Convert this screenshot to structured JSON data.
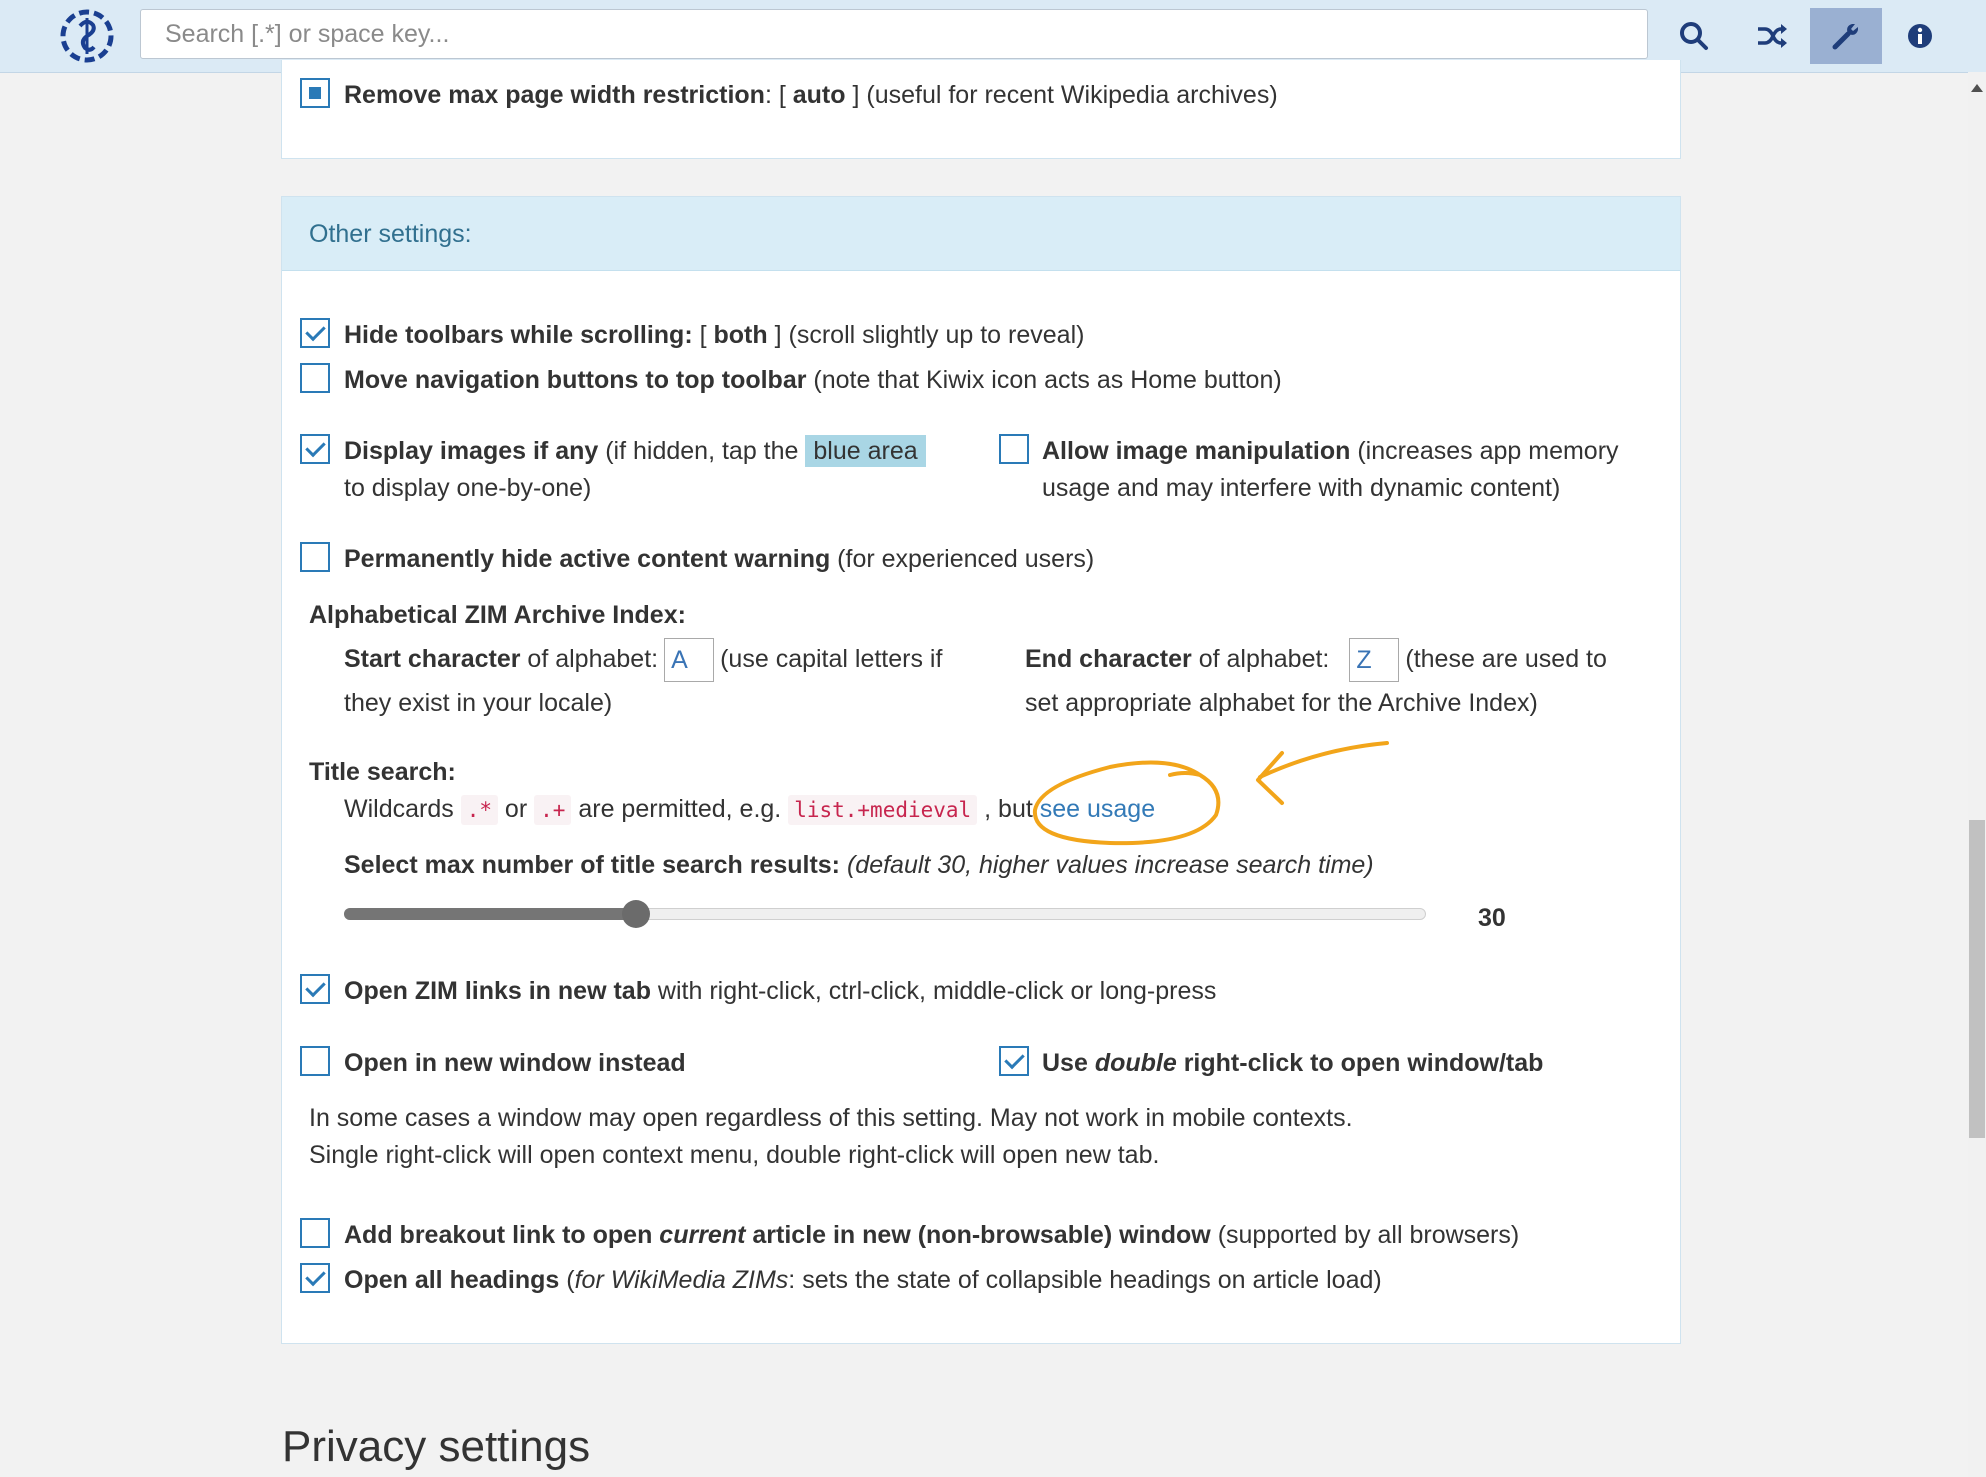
{
  "toolbar": {
    "search_placeholder": "Search [.*] or space key...",
    "buttons": [
      "search-icon",
      "random-shuffle-icon",
      "wrench-settings-icon",
      "info-icon"
    ],
    "active_button": "wrench-settings-icon"
  },
  "display": {
    "max_width": {
      "label": "Remove max page width restriction",
      "state_open": ": [ ",
      "state": "auto",
      "state_close": " ]",
      "note": " (useful for recent Wikipedia archives)"
    }
  },
  "other": {
    "header": "Other settings:",
    "hide_toolbars": {
      "label": "Hide toolbars while scrolling:",
      "open": " [ ",
      "state": "both",
      "close": " ]",
      "note": " (scroll slightly up to reveal)"
    },
    "move_nav": {
      "label": "Move navigation buttons to top toolbar",
      "note": " (note that Kiwix icon acts as Home button)"
    },
    "display_images": {
      "label": "Display images if any",
      "note": " (if hidden, tap the ",
      "highlight": "blue area",
      "note2": "to display one-by-one)"
    },
    "image_manip": {
      "label": "Allow image manipulation",
      "note": " (increases app memory",
      "note2": "usage and may interfere with dynamic content)"
    },
    "hide_warning": {
      "label": "Permanently hide active content warning",
      "note": " (for experienced users)"
    },
    "alpha": {
      "title": "Alphabetical ZIM Archive Index:",
      "start_label": "Start character",
      "start_text": " of alphabet:",
      "start_value": "A",
      "start_note": "(use capital letters if",
      "start_note2": "they exist in your locale)",
      "end_label": "End character",
      "end_text": " of alphabet:",
      "end_value": "Z",
      "end_note": "(these are used to",
      "end_note2": "set appropriate alphabet for the Archive Index)"
    },
    "title_search": {
      "title": "Title search:",
      "w1": "Wildcards ",
      "code1": ".*",
      "w2": " or ",
      "code2": ".+",
      "w3": " are permitted, e.g. ",
      "code3": "list.+medieval",
      "w4": " , but ",
      "link": "see usage",
      "max_label": "Select max number of title search results:",
      "max_note": "(default 30, higher values increase search time)",
      "value": 30,
      "value_text": "30",
      "slider_fraction": 0.27
    },
    "open_links": {
      "label": "Open ZIM links in new tab",
      "note": " with right-click, ctrl-click, middle-click or long-press"
    },
    "new_window": {
      "label": "Open in new window instead"
    },
    "double_click": {
      "pre": "Use ",
      "em": "double",
      "post": " right-click to open window/tab"
    },
    "window_note1": "In some cases a window may open regardless of this setting. May not work in mobile contexts.",
    "window_note2": "Single right-click will open context menu, double right-click will open new tab.",
    "breakout": {
      "pre": "Add breakout link to open ",
      "em": "current",
      "post": " article in new (non-browsable) window",
      "note": " (supported by all browsers)"
    },
    "headings": {
      "label": "Open all headings",
      "note_open": " (",
      "note_em": "for WikiMedia ZIMs",
      "note": ": sets the state of collapsible headings on article load)"
    }
  },
  "privacy_title": "Privacy settings",
  "colors": {
    "toolbar_bg": "#dbeaf5",
    "panel_header": "#d9edf7",
    "checkbox": "#2a7ab7",
    "annotation": "#f2a51a"
  }
}
